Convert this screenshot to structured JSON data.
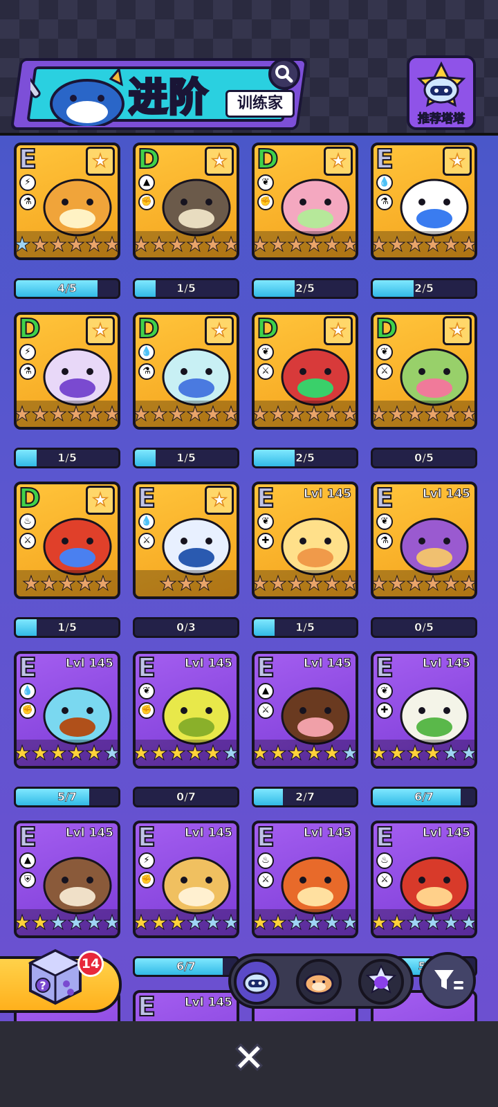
{
  "header": {
    "title": "进阶",
    "subtitle": "训练家",
    "recommend_label": "推荐塔塔"
  },
  "colors": {
    "star_bronze": "#e9a46a",
    "star_gold": "#ffd23a",
    "star_blue": "#9fd4f4",
    "card_gold": "#f4a21c",
    "card_purple": "#8f48e2"
  },
  "cards": [
    {
      "rank": "E",
      "element": "lightning-icon",
      "cls": "potion-icon",
      "level": "",
      "favorite": true,
      "bg": "gold",
      "stars": [
        "blue",
        "bronze",
        "bronze",
        "bronze",
        "bronze",
        "bronze"
      ],
      "progress": "4/5",
      "fill": 0.8,
      "body": "#f0a43a",
      "accent": "#fff2c4"
    },
    {
      "rank": "D",
      "element": "earth-icon",
      "cls": "fist-icon",
      "level": "",
      "favorite": true,
      "bg": "gold",
      "stars": [
        "bronze",
        "bronze",
        "bronze",
        "bronze",
        "bronze",
        "bronze"
      ],
      "progress": "1/5",
      "fill": 0.2,
      "body": "#6b5a4a",
      "accent": "#e8dcc0"
    },
    {
      "rank": "D",
      "element": "leaf-icon",
      "cls": "fist-icon",
      "level": "",
      "favorite": true,
      "bg": "gold",
      "stars": [
        "bronze",
        "bronze",
        "bronze",
        "bronze",
        "bronze",
        "bronze"
      ],
      "progress": "2/5",
      "fill": 0.4,
      "body": "#f4a8c0",
      "accent": "#b6e89a"
    },
    {
      "rank": "E",
      "element": "water-icon",
      "cls": "potion-icon",
      "level": "",
      "favorite": true,
      "bg": "gold",
      "stars": [
        "bronze",
        "bronze",
        "bronze",
        "bronze",
        "bronze",
        "bronze"
      ],
      "progress": "2/5",
      "fill": 0.4,
      "body": "#ffffff",
      "accent": "#3a7cf0"
    },
    {
      "rank": "D",
      "element": "lightning-icon",
      "cls": "potion-icon",
      "level": "",
      "favorite": true,
      "bg": "gold",
      "stars": [
        "bronze",
        "bronze",
        "bronze",
        "bronze",
        "bronze",
        "bronze"
      ],
      "progress": "1/5",
      "fill": 0.2,
      "body": "#e8d8f8",
      "accent": "#7a4ad0"
    },
    {
      "rank": "D",
      "element": "water-icon",
      "cls": "potion-icon",
      "level": "",
      "favorite": true,
      "bg": "gold",
      "stars": [
        "bronze",
        "bronze",
        "bronze",
        "bronze",
        "bronze",
        "bronze"
      ],
      "progress": "1/5",
      "fill": 0.2,
      "body": "#c8f0f4",
      "accent": "#4a7ae0"
    },
    {
      "rank": "D",
      "element": "leaf-icon",
      "cls": "sword-icon",
      "level": "",
      "favorite": true,
      "bg": "gold",
      "stars": [
        "bronze",
        "bronze",
        "bronze",
        "bronze",
        "bronze",
        "bronze"
      ],
      "progress": "2/5",
      "fill": 0.4,
      "body": "#d83a3a",
      "accent": "#3ad06a"
    },
    {
      "rank": "D",
      "element": "leaf-icon",
      "cls": "sword-icon",
      "level": "",
      "favorite": true,
      "bg": "gold",
      "stars": [
        "bronze",
        "bronze",
        "bronze",
        "bronze",
        "bronze",
        "bronze"
      ],
      "progress": "0/5",
      "fill": 0,
      "body": "#98d06a",
      "accent": "#f07a9a"
    },
    {
      "rank": "D",
      "element": "fire-icon",
      "cls": "sword-icon",
      "level": "",
      "favorite": true,
      "bg": "gold",
      "stars": [
        "bronze",
        "bronze",
        "bronze",
        "bronze",
        "bronze"
      ],
      "progress": "1/5",
      "fill": 0.2,
      "body": "#e0402a",
      "accent": "#4a80f0"
    },
    {
      "rank": "E",
      "element": "water-icon",
      "cls": "sword-icon",
      "level": "",
      "favorite": true,
      "bg": "gold",
      "stars": [
        "bronze",
        "bronze",
        "bronze"
      ],
      "progress": "0/3",
      "fill": 0,
      "body": "#e8f0ff",
      "accent": "#2a5ab0"
    },
    {
      "rank": "E",
      "element": "leaf-icon",
      "cls": "heal-icon",
      "level": "Lvl 145",
      "favorite": false,
      "bg": "gold",
      "stars": [
        "bronze",
        "bronze",
        "bronze",
        "bronze",
        "bronze",
        "bronze"
      ],
      "progress": "1/5",
      "fill": 0.2,
      "body": "#ffe08a",
      "accent": "#f09a4a"
    },
    {
      "rank": "E",
      "element": "leaf-icon",
      "cls": "potion-icon",
      "level": "Lvl 145",
      "favorite": false,
      "bg": "gold",
      "stars": [
        "bronze",
        "bronze",
        "bronze",
        "bronze",
        "bronze",
        "bronze"
      ],
      "progress": "0/5",
      "fill": 0,
      "body": "#9a5ad0",
      "accent": "#f0c070"
    },
    {
      "rank": "E",
      "element": "water-icon",
      "cls": "fist-icon",
      "level": "Lvl 145",
      "favorite": false,
      "bg": "purple",
      "stars": [
        "gold",
        "gold",
        "gold",
        "gold",
        "gold",
        "blue"
      ],
      "progress": "5/7",
      "fill": 0.714,
      "body": "#7ad8f0",
      "accent": "#b0501a"
    },
    {
      "rank": "E",
      "element": "leaf-icon",
      "cls": "fist-icon",
      "level": "Lvl 145",
      "favorite": false,
      "bg": "purple",
      "stars": [
        "gold",
        "gold",
        "gold",
        "gold",
        "gold",
        "blue"
      ],
      "progress": "0/7",
      "fill": 0,
      "body": "#e8e84a",
      "accent": "#8ab02a"
    },
    {
      "rank": "E",
      "element": "earth-icon",
      "cls": "sword-icon",
      "level": "Lvl 145",
      "favorite": false,
      "bg": "purple",
      "stars": [
        "gold",
        "gold",
        "gold",
        "gold",
        "gold",
        "blue"
      ],
      "progress": "2/7",
      "fill": 0.286,
      "body": "#6a3a20",
      "accent": "#f0a0a8"
    },
    {
      "rank": "E",
      "element": "leaf-icon",
      "cls": "heal-icon",
      "level": "Lvl 145",
      "favorite": false,
      "bg": "purple",
      "stars": [
        "gold",
        "gold",
        "gold",
        "gold",
        "blue",
        "blue"
      ],
      "progress": "6/7",
      "fill": 0.857,
      "body": "#f4f4e8",
      "accent": "#5ab84a"
    },
    {
      "rank": "E",
      "element": "earth-icon",
      "cls": "shield-icon",
      "level": "Lvl 145",
      "favorite": false,
      "bg": "purple",
      "stars": [
        "gold",
        "gold",
        "blue",
        "blue",
        "blue",
        "blue"
      ],
      "progress": "",
      "fill": 0,
      "body": "#8a5a3a",
      "accent": "#f0e0c8"
    },
    {
      "rank": "E",
      "element": "lightning-icon",
      "cls": "fist-icon",
      "level": "Lvl 145",
      "favorite": false,
      "bg": "purple",
      "stars": [
        "gold",
        "gold",
        "gold",
        "blue",
        "blue",
        "blue"
      ],
      "progress": "6/7",
      "fill": 0.857,
      "body": "#f0c060",
      "accent": "#fff0d0"
    },
    {
      "rank": "E",
      "element": "fire-icon",
      "cls": "sword-icon",
      "level": "Lvl 145",
      "favorite": false,
      "bg": "purple",
      "stars": [
        "gold",
        "gold",
        "blue",
        "blue",
        "blue",
        "blue"
      ],
      "progress": "",
      "fill": 0,
      "body": "#e86a2a",
      "accent": "#ffe0a0"
    },
    {
      "rank": "E",
      "element": "fire-icon",
      "cls": "sword-icon",
      "level": "Lvl 145",
      "favorite": false,
      "bg": "purple",
      "stars": [
        "gold",
        "gold",
        "blue",
        "blue",
        "blue",
        "blue"
      ],
      "progress": "5/",
      "fill": 0.6,
      "body": "#d83a2a",
      "accent": "#ffd08a"
    },
    {
      "rank": "",
      "element": "",
      "cls": "",
      "level": "",
      "favorite": false,
      "bg": "purple",
      "stars": [],
      "progress": "",
      "fill": 0,
      "body": "#4a2a5a",
      "accent": "#4a2a5a"
    },
    {
      "rank": "E",
      "element": "",
      "cls": "",
      "level": "Lvl 145",
      "favorite": false,
      "bg": "purple",
      "stars": [],
      "progress": "",
      "fill": 0,
      "body": "#e8702a",
      "accent": "#3aa040"
    },
    {
      "rank": "",
      "element": "",
      "cls": "",
      "level": "",
      "favorite": false,
      "bg": "purple",
      "stars": [],
      "progress": "",
      "fill": 0,
      "body": "#4a2a5a",
      "accent": "#4a2a5a"
    },
    {
      "rank": "",
      "element": "",
      "cls": "",
      "level": "",
      "favorite": false,
      "bg": "purple",
      "stars": [],
      "progress": "",
      "fill": 0,
      "body": "#4a2a5a",
      "accent": "#4a2a5a"
    }
  ],
  "dice_badge": "14",
  "tabs": [
    {
      "name": "tab-creature-icon",
      "color": "#5b4ac8"
    },
    {
      "name": "tab-hamster-icon",
      "color": "#2a2a3e"
    },
    {
      "name": "tab-spirit-icon",
      "color": "#2a2a3e"
    }
  ],
  "icons": {
    "search": "search-icon",
    "filter": "filter-icon",
    "close": "close-icon",
    "dice": "mystery-dice-icon"
  }
}
